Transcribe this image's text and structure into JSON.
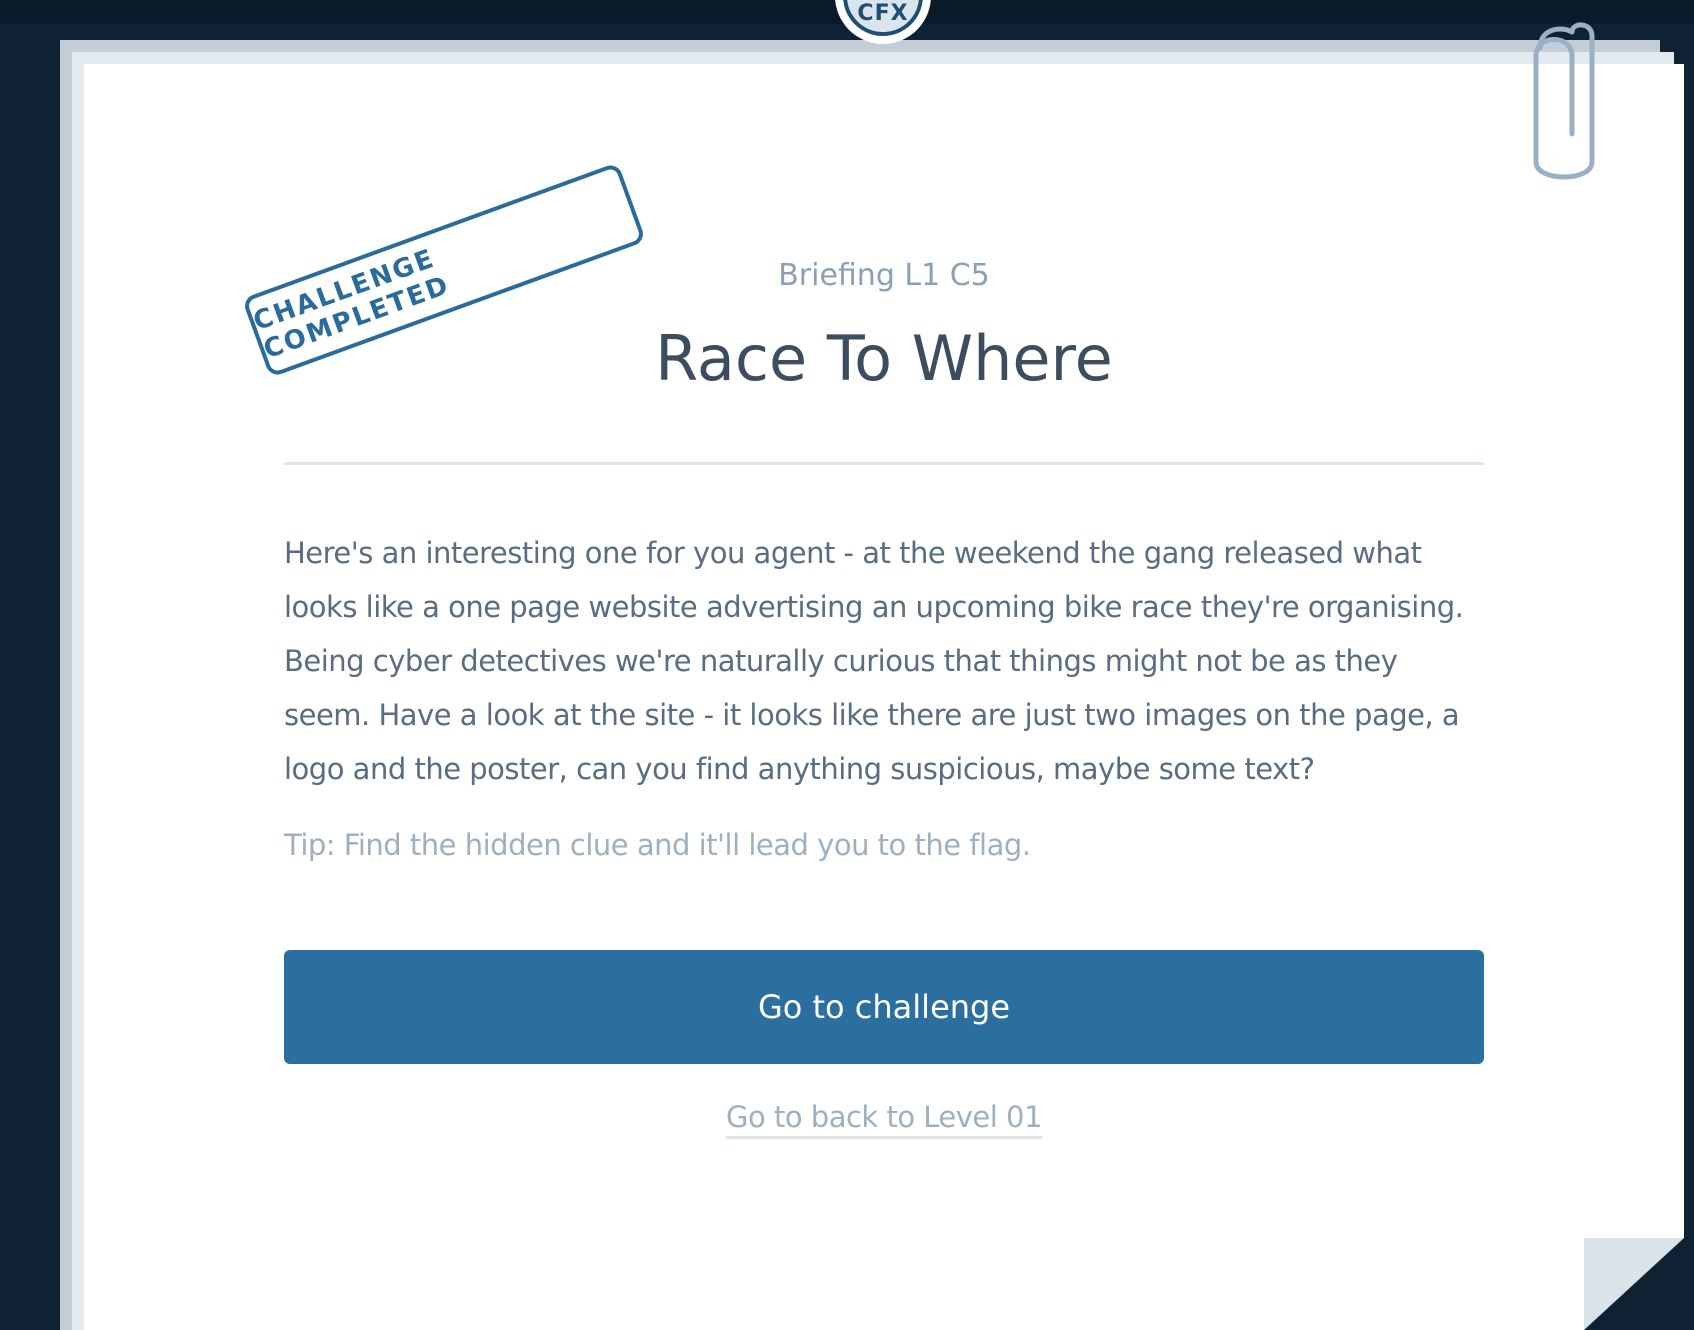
{
  "logo": {
    "badge_text": "CFX"
  },
  "stamp": {
    "label": "CHALLENGE COMPLETED"
  },
  "briefing": {
    "label": "Briefing L1 C5",
    "title": "Race To Where",
    "body": "Here's an interesting one for you agent - at the weekend the gang released what looks like a one page website advertising an upcoming bike race they're organising. Being cyber detectives we're naturally curious that things might not be as they seem. Have a look at the site - it looks like there are just two images on the page, a logo and the poster, can you find anything suspicious, maybe some text?",
    "tip": "Tip: Find the hidden clue and it'll lead you to the flag."
  },
  "actions": {
    "go_to_challenge": "Go to challenge",
    "back_link": "Go to back to Level 01"
  },
  "icons": {
    "paperclip": "paperclip-icon",
    "page_fold": "page-fold-icon"
  },
  "colors": {
    "background": "#0e2233",
    "accent": "#2a6f9f",
    "stamp": "#2a6b9b",
    "title": "#3b4d5f",
    "body": "#586d82",
    "muted": "#9eb0c0"
  }
}
